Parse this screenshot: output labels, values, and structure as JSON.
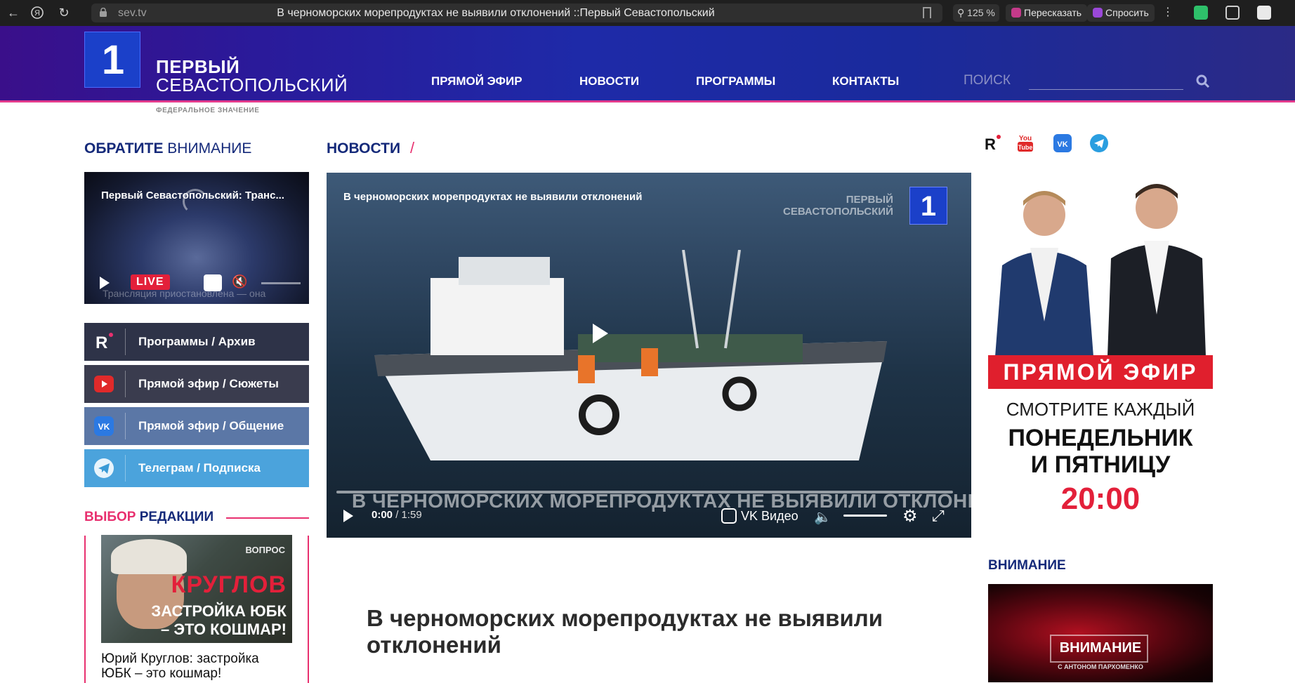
{
  "browser": {
    "url": "sev.tv",
    "tab_title": "В черноморских морепродуктах не выявили отклонений ::Первый Севастопольский",
    "zoom": "125 %",
    "retell_label": "Пересказать",
    "ask_label": "Спросить"
  },
  "header": {
    "brand_line1": "ПЕРВЫЙ",
    "brand_line2": "СЕВАСТОПОЛЬСКИЙ",
    "brand_tagline": "ФЕДЕРАЛЬНОЕ ЗНАЧЕНИЕ",
    "logo_digit": "1",
    "nav": [
      "ПРЯМОЙ ЭФИР",
      "НОВОСТИ",
      "ПРОГРАММЫ",
      "КОНТАКТЫ"
    ],
    "search_label": "ПОИСК",
    "search_value": ""
  },
  "left": {
    "attention_title_bold": "ОБРАТИТЕ",
    "attention_title_rest": " ВНИМАНИЕ",
    "live_player": {
      "title": "Первый Севастопольский: Транс...",
      "status": "Трансляция приостановлена — она",
      "live_label": "LIVE"
    },
    "buttons": [
      {
        "label": "Программы / Архив",
        "icon": "rutube-icon"
      },
      {
        "label": "Прямой эфир / Сюжеты",
        "icon": "youtube-icon"
      },
      {
        "label": "Прямой эфир / Общение",
        "icon": "vk-icon"
      },
      {
        "label": "Телеграм / Подписка",
        "icon": "telegram-icon"
      }
    ],
    "editor_title_accent": "ВЫБОР",
    "editor_title_rest": " РЕДАКЦИИ",
    "editor_card": {
      "thumb_small": "ВОПРОС",
      "thumb_big": "КРУГЛОВ",
      "thumb_line1": "ЗАСТРОЙКА ЮБК",
      "thumb_line2": "– ЭТО КОШМАР!",
      "caption": "Юрий Круглов: застройка ЮБК – это кошмар!"
    }
  },
  "main": {
    "section_title": "НОВОСТИ",
    "section_slash": "/",
    "video": {
      "title": "В черноморских морепродуктах не выявили отклонений",
      "bug_line1": "ПЕРВЫЙ",
      "bug_line2": "СЕВАСТОПОЛЬСКИЙ",
      "bug_digit": "1",
      "caption": "В ЧЕРНОМОРСКИХ МОРЕПРОДУКТАХ НЕ ВЫЯВИЛИ ОТКЛОНЕНИЙ",
      "time_current": "0:00",
      "time_sep": " / ",
      "time_total": "1:59",
      "provider": "VK Видео",
      "progress": 0
    },
    "article_title": "В черноморских морепродуктах не выявили отклонений"
  },
  "right": {
    "socials": [
      "rutube-icon",
      "youtube-icon",
      "vk-icon",
      "telegram-icon"
    ],
    "youtube_text_top": "You",
    "youtube_text_bottom": "Tube",
    "promo": {
      "band": "ПРЯМОЙ ЭФИР",
      "watch": "СМОТРИТЕ КАЖДЫЙ",
      "days_line1": "ПОНЕДЕЛЬНИК",
      "days_line2": "И ПЯТНИЦУ",
      "time": "20:00"
    },
    "attention_title": "ВНИМАНИЕ",
    "attention_thumb_label": "ВНИМАНИЕ",
    "attention_thumb_sub": "С АНТОНОМ ПАРХОМЕНКО"
  },
  "colors": {
    "accent_pink": "#e8306f",
    "brand_blue": "#152a7a",
    "live_red": "#e3203a"
  }
}
